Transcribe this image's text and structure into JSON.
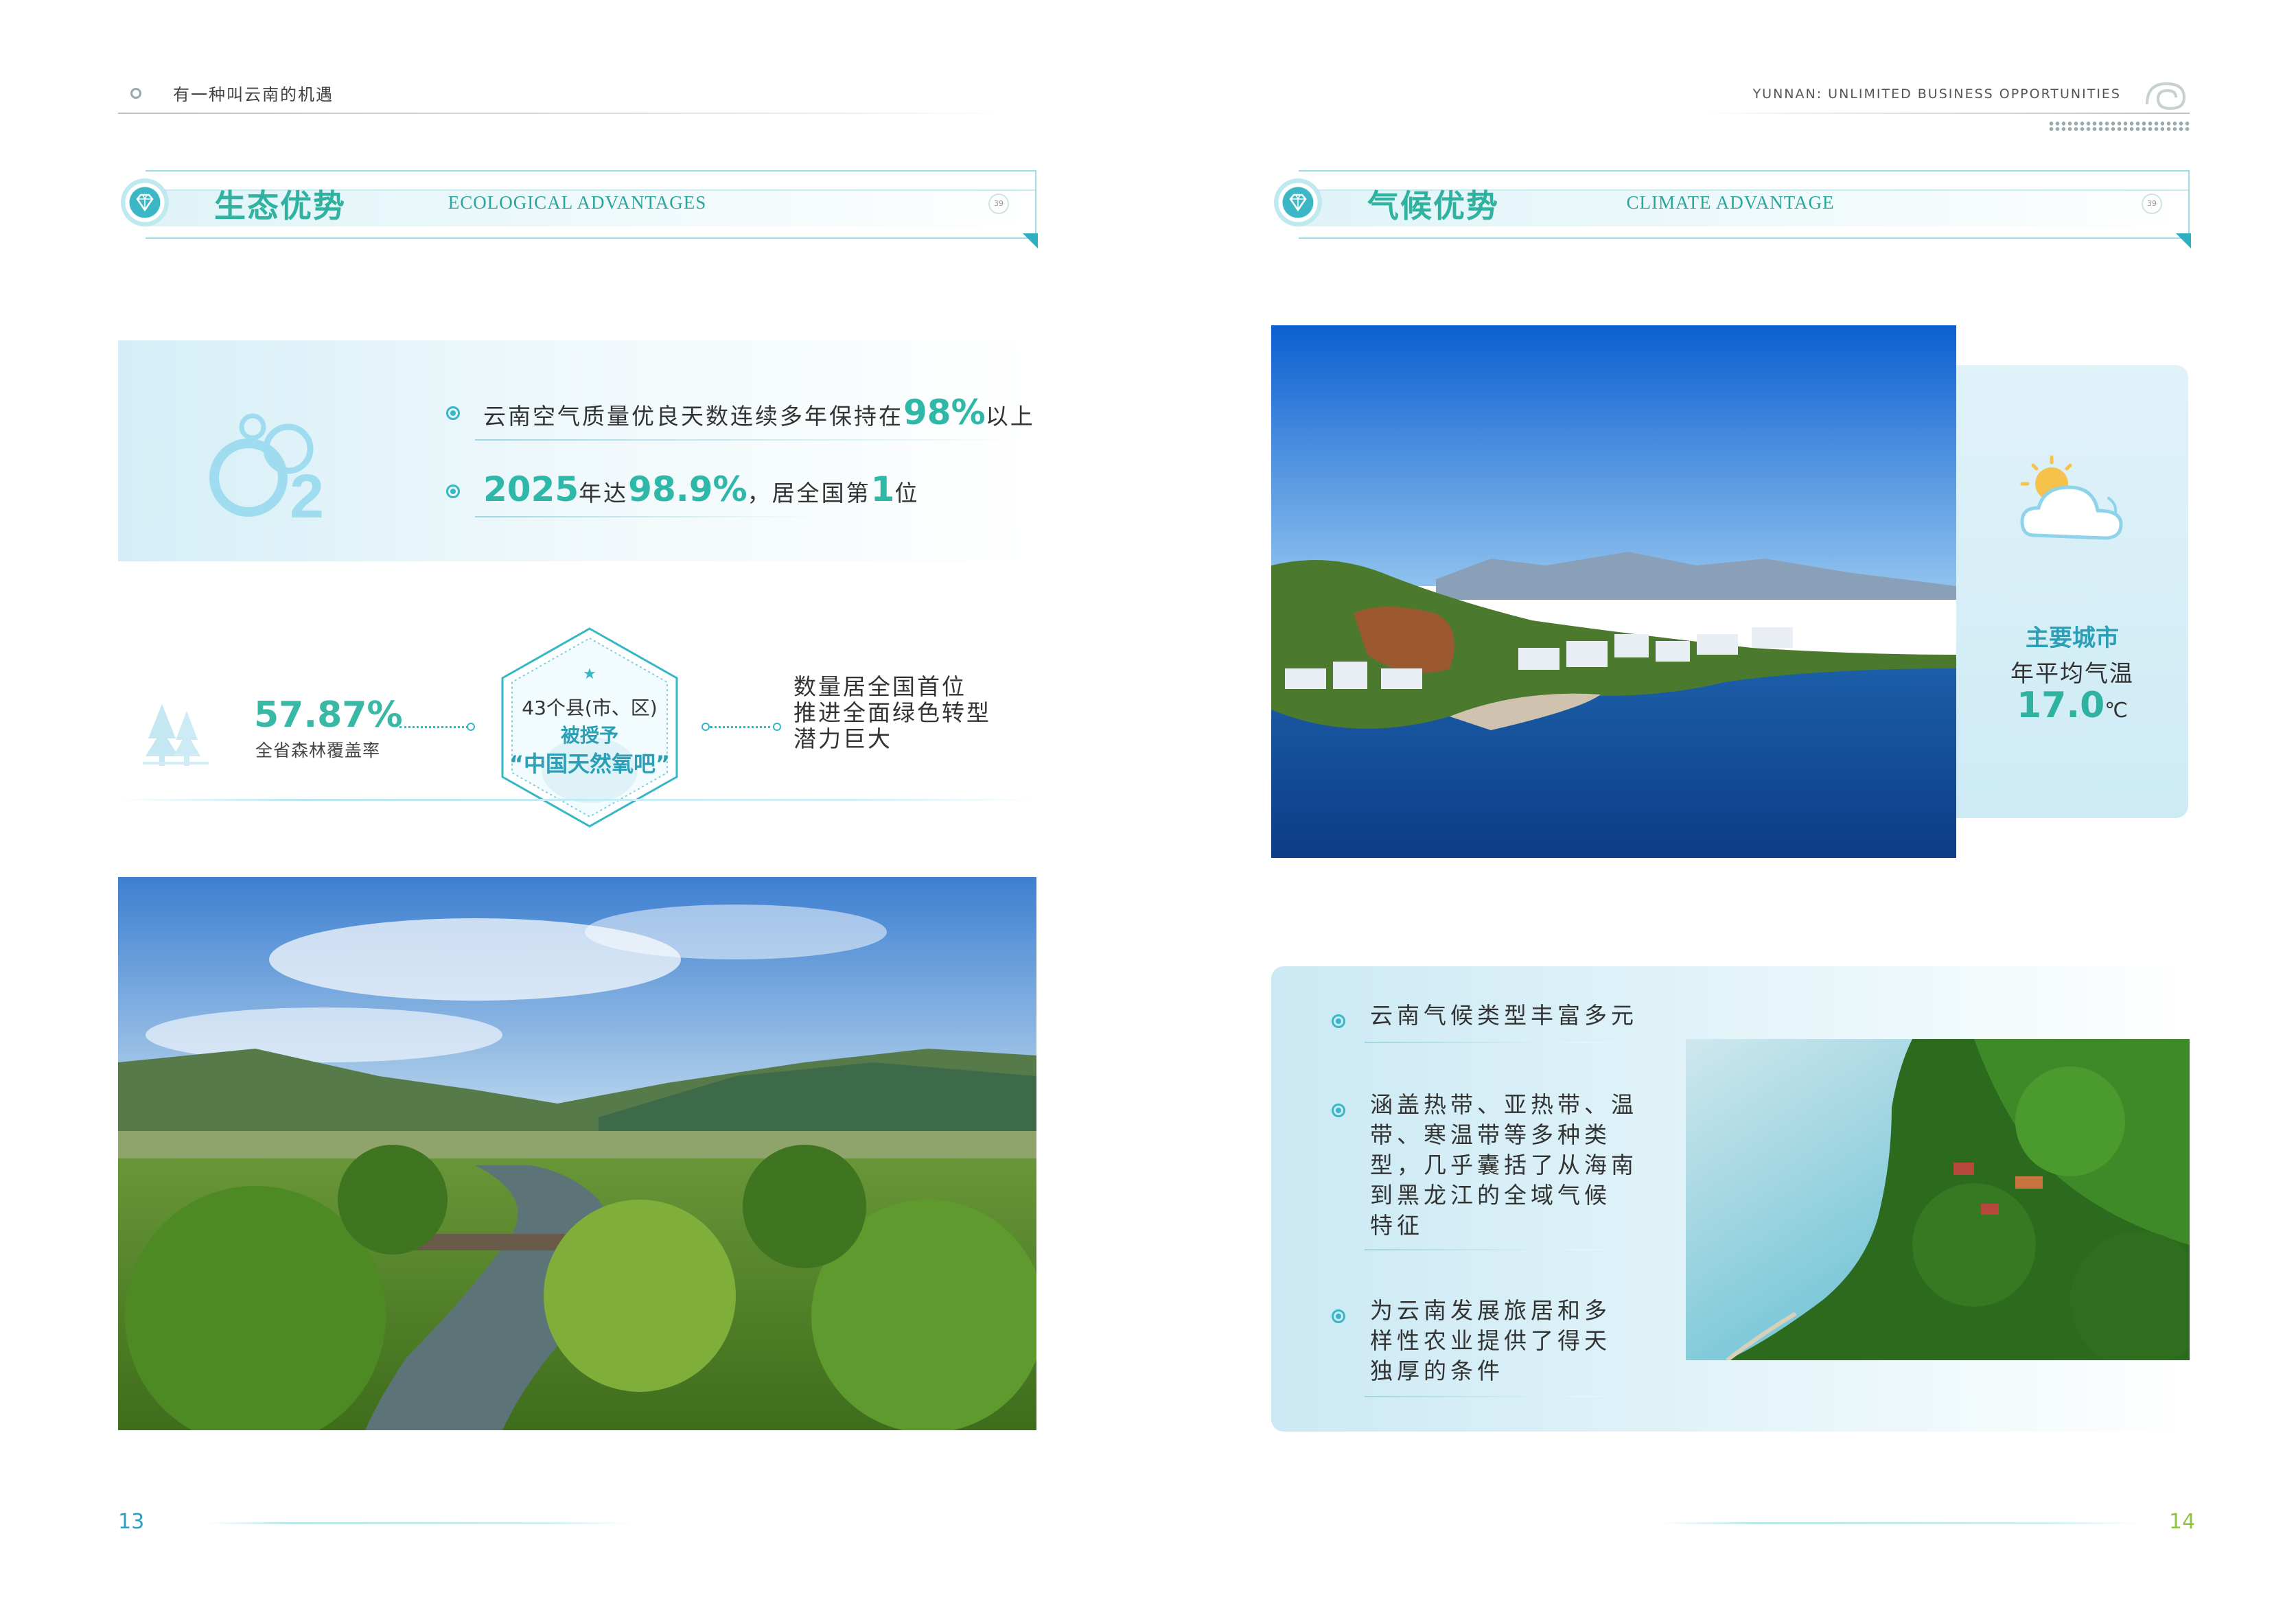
{
  "header": {
    "left_title": "有一种叫云南的机遇",
    "right_title": "YUNNAN: UNLIMITED BUSINESS OPPORTUNITIES"
  },
  "left": {
    "section": {
      "cn": "生态优势",
      "en": "ECOLOGICAL ADVANTAGES",
      "badge": "39"
    },
    "o2": {
      "icon": "o2-bubbles-icon",
      "line1": {
        "pre": "云南空气质量优良天数连续多年保持在",
        "num": "98%",
        "post": "以上"
      },
      "line2": {
        "num1": "2025",
        "mid": "年达",
        "num2": "98.9%",
        "mid2": "，居全国第",
        "num3": "1",
        "post": "位"
      }
    },
    "forest": {
      "icon": "tree-icon",
      "percent": "57.87%",
      "label": "全省森林覆盖率",
      "hex_star": "★",
      "hex_line1": "43个县(市、区)",
      "hex_line2": "被授予",
      "hex_line3": "“中国天然氧吧”",
      "right_line1": "数量居全国首位",
      "right_line2": "推进全面绿色转型",
      "right_line3": "潜力巨大"
    },
    "page_number": "13"
  },
  "right": {
    "section": {
      "cn": "气候优势",
      "en": "CLIMATE ADVANTAGE",
      "badge": "39"
    },
    "temp": {
      "icon": "sun-cloud-icon",
      "title": "主要城市",
      "label": "年平均气温",
      "value": "17.0",
      "unit": "℃"
    },
    "climate": {
      "item1": "云南气候类型丰富多元",
      "item2_lines": [
        "涵盖热带、亚热带、温",
        "带、寒温带等多种类",
        "型，几乎囊括了从海南",
        "到黑龙江的全域气候",
        "特征"
      ],
      "item3_lines": [
        "为云南发展旅居和多",
        "样性农业提供了得天",
        "独厚的条件"
      ]
    },
    "page_number": "14"
  },
  "colors": {
    "accent": "#2fb29f",
    "teal": "#36b7c5",
    "page_left": "#2f9fc0",
    "page_right": "#8cc63f"
  }
}
